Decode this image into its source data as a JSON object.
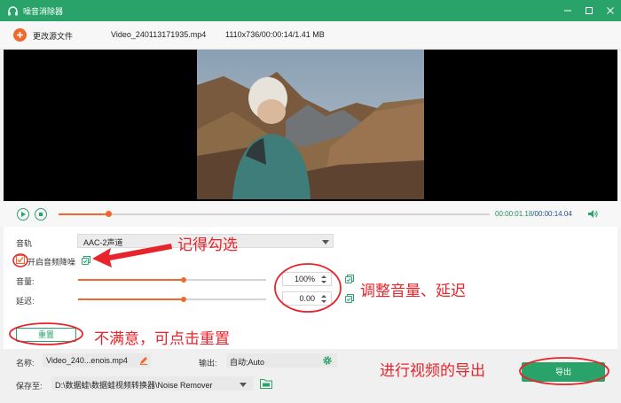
{
  "window": {
    "title": "噪音消除器",
    "controls": [
      "minimize-icon",
      "maximize-icon",
      "close-icon"
    ]
  },
  "toolbar": {
    "change_source_label": "更改源文件",
    "filename": "Video_240113171935.mp4",
    "fileinfo": "1110x736/00:00:14/1.41 MB"
  },
  "playback": {
    "current_time": "00:00:01.18",
    "total_time": "/00:00:14.04",
    "progress_fraction": 0.115
  },
  "settings": {
    "track_label": "音轨",
    "track_value": "AAC-2声道",
    "denoise_label": "开启音频降噪",
    "denoise_checked": true,
    "volume_label": "音量:",
    "volume_value": "100%",
    "volume_fraction": 0.56,
    "delay_label": "延迟:",
    "delay_value": "0.00",
    "delay_fraction": 0.56,
    "reset_label": "重置"
  },
  "output": {
    "name_label": "名称:",
    "name_value": "Video_240...enois.mp4",
    "format_label": "输出:",
    "format_value": "自动;Auto",
    "save_label": "保存至:",
    "save_path": "D:\\数据蛙\\数据蛙视频转换器\\Noise Remover",
    "export_label": "导出"
  },
  "annotations": {
    "check_note": "记得勾选",
    "adjust_note": "调整音量、延迟",
    "reset_note": "不满意，可点击重置",
    "export_note": "进行视频的导出",
    "color": "#e8232b"
  },
  "colors": {
    "accent_green": "#2aa36b",
    "accent_orange": "#f0682d"
  }
}
